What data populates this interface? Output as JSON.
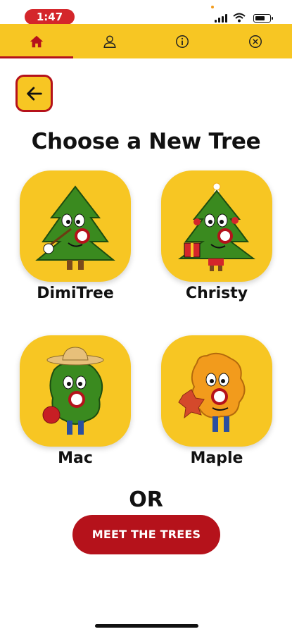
{
  "status_bar": {
    "time": "1:47",
    "accent_color": "#d4262b",
    "icons": [
      "cellular-signal-icon",
      "wifi-icon",
      "battery-icon"
    ]
  },
  "nav": {
    "tabs": [
      {
        "icon": "home-icon",
        "active": true
      },
      {
        "icon": "profile-icon",
        "active": false
      },
      {
        "icon": "info-icon",
        "active": false
      },
      {
        "icon": "close-circle-icon",
        "active": false
      }
    ],
    "background_color": "#f7c623",
    "active_color": "#b5121b"
  },
  "back_button": {
    "icon": "arrow-left-icon"
  },
  "page": {
    "title": "Choose a New Tree",
    "or_label": "OR",
    "meet_button_label": "MEET THE TREES"
  },
  "trees": [
    {
      "name": "DimiTree",
      "icon": "pine-tree-character-icon"
    },
    {
      "name": "Christy",
      "icon": "christmas-tree-character-icon"
    },
    {
      "name": "Mac",
      "icon": "apple-tree-character-icon"
    },
    {
      "name": "Maple",
      "icon": "maple-tree-character-icon"
    }
  ],
  "colors": {
    "brand_yellow": "#f7c623",
    "brand_red": "#b5121b",
    "tree_green": "#3a8a1f",
    "maple_orange": "#f29b1c"
  }
}
